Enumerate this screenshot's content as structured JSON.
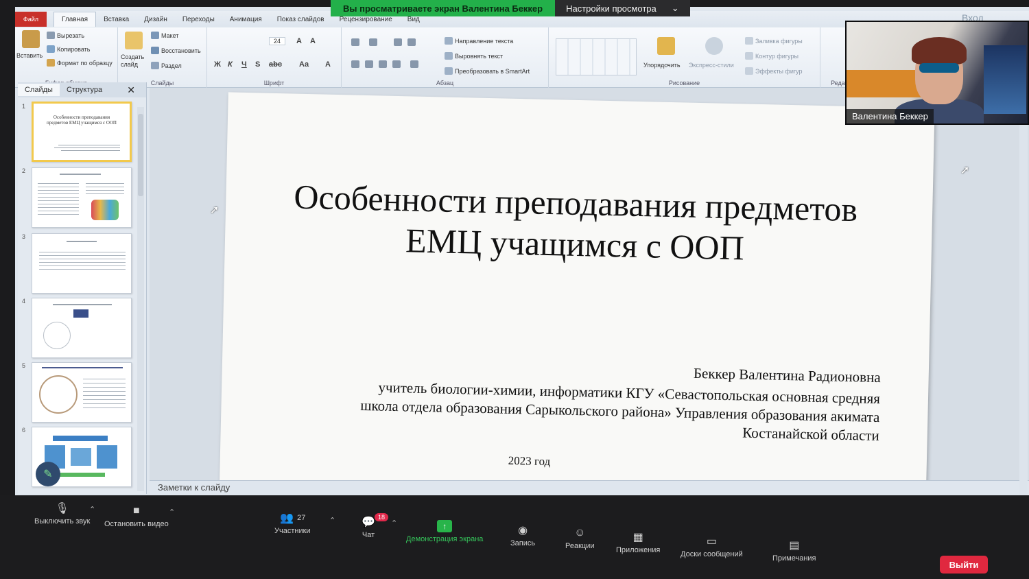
{
  "share_banner": {
    "viewing_text": "Вы просматриваете экран Валентина Беккер",
    "view_options": "Настройки просмотра"
  },
  "ppt": {
    "file_tab": "Файл",
    "tabs": [
      "Главная",
      "Вставка",
      "Дизайн",
      "Переходы",
      "Анимация",
      "Показ слайдов",
      "Рецензирование",
      "Вид"
    ],
    "window_login": "Вход",
    "ribbon": {
      "clipboard": {
        "paste": "Вставить",
        "cut": "Вырезать",
        "copy": "Копировать",
        "format_painter": "Формат по образцу",
        "label": "Буфер обмена"
      },
      "slides": {
        "new_slide": "Создать слайд",
        "layout": "Макет",
        "reset": "Восстановить",
        "section": "Раздел",
        "label": "Слайды"
      },
      "font": {
        "size": "24",
        "label": "Шрифт"
      },
      "paragraph": {
        "text_direction": "Направление текста",
        "align_text": "Выровнять текст",
        "smartart": "Преобразовать в SmartArt",
        "label": "Абзац"
      },
      "drawing": {
        "arrange": "Упорядочить",
        "quick_styles": "Экспресс-стили",
        "shape_fill": "Заливка фигуры",
        "shape_outline": "Контур фигуры",
        "shape_effects": "Эффекты фигур",
        "label": "Рисование"
      },
      "editing": {
        "label": "Редакт"
      }
    },
    "pane": {
      "tab_slides": "Слайды",
      "tab_outline": "Структура",
      "thumbnails": [
        "1",
        "2",
        "3",
        "4",
        "5",
        "6"
      ],
      "thumb1_text": "Особенности преподавания предметов ЕМЦ учащимся с ООП"
    },
    "slide": {
      "title": "Особенности преподавания предметов ЕМЦ учащимся с ООП",
      "author": "Беккер Валентина Радионовна",
      "affiliation": "учитель биологии-химии, информатики КГУ «Севастопольская основная средняя школа отдела образования Сарыкольского района» Управления образования акимата Костанайской области",
      "year": "2023 год"
    },
    "notes_placeholder": "Заметки к слайду"
  },
  "webcam": {
    "participant_name": "Валентина Беккер"
  },
  "toolbar": {
    "mute": "Выключить звук",
    "stop_video": "Остановить видео",
    "participants": "Участники",
    "participants_count": "27",
    "chat": "Чат",
    "chat_badge": "18",
    "share_screen": "Демонстрация экрана",
    "record": "Запись",
    "reactions": "Реакции",
    "apps": "Приложения",
    "whiteboards": "Доски сообщений",
    "notes": "Примечания",
    "leave": "Выйти"
  }
}
